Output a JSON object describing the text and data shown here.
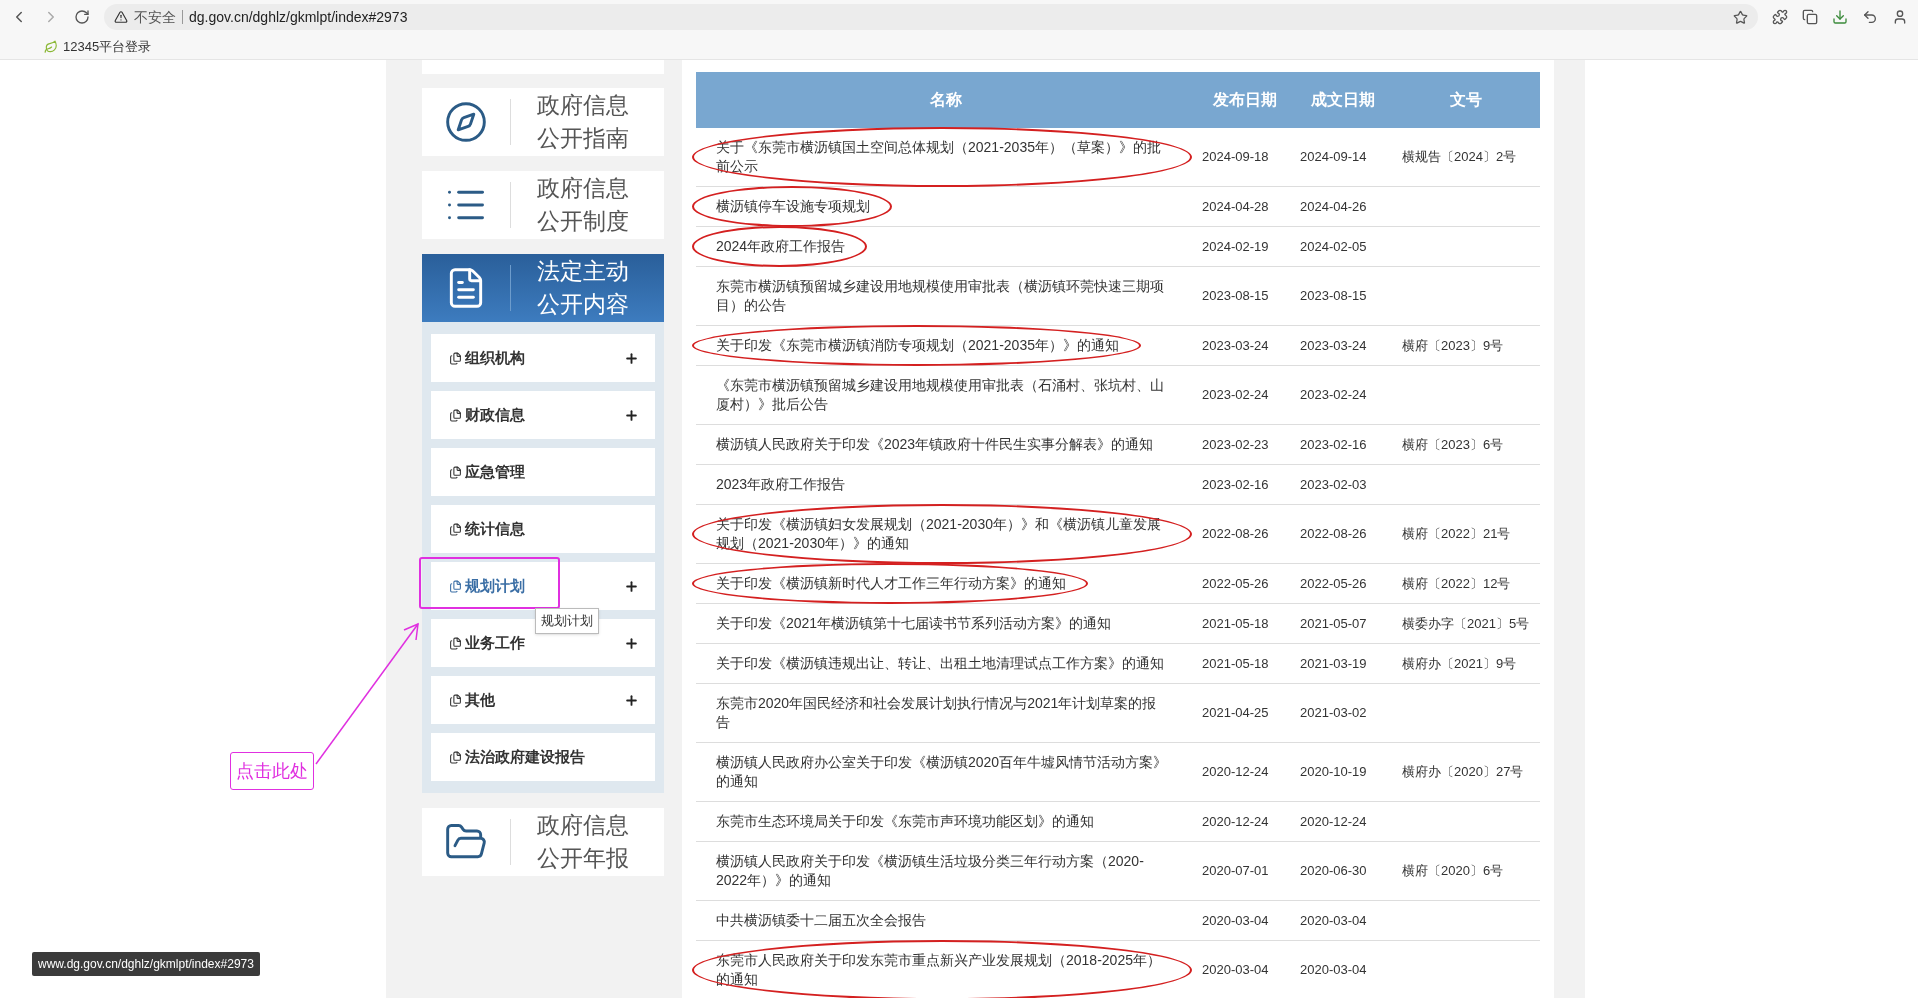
{
  "browser": {
    "security_label": "不安全",
    "url": "dg.gov.cn/dghlz/gkmlpt/index#2973",
    "bookmarks": [
      {
        "label": "12345平台登录"
      }
    ],
    "status_url": "www.dg.gov.cn/dghlz/gkmlpt/index#2973"
  },
  "sidebar": {
    "cards": [
      {
        "kind": "compass",
        "lines": [
          "政府信息",
          "公开指南"
        ],
        "selected": false
      },
      {
        "kind": "list",
        "lines": [
          "政府信息",
          "公开制度"
        ],
        "selected": false
      },
      {
        "kind": "document",
        "lines": [
          "法定主动",
          "公开内容"
        ],
        "selected": true,
        "items": [
          {
            "label": "组织机构",
            "expandable": true,
            "hovered": false,
            "highlighted": false
          },
          {
            "label": "财政信息",
            "expandable": true,
            "hovered": false,
            "highlighted": false
          },
          {
            "label": "应急管理",
            "expandable": false,
            "hovered": false,
            "highlighted": false
          },
          {
            "label": "统计信息",
            "expandable": false,
            "hovered": false,
            "highlighted": false
          },
          {
            "label": "规划计划",
            "expandable": true,
            "hovered": true,
            "highlighted": true,
            "tooltip": "规划计划"
          },
          {
            "label": "业务工作",
            "expandable": true,
            "hovered": false,
            "highlighted": false
          },
          {
            "label": "其他",
            "expandable": true,
            "hovered": false,
            "highlighted": false
          },
          {
            "label": "法治政府建设报告",
            "expandable": false,
            "hovered": false,
            "highlighted": false
          }
        ]
      },
      {
        "kind": "folder",
        "lines": [
          "政府信息",
          "公开年报"
        ],
        "selected": false
      }
    ]
  },
  "callout": {
    "label": "点击此处"
  },
  "table": {
    "columns": [
      "名称",
      "发布日期",
      "成文日期",
      "文号"
    ],
    "rows": [
      {
        "name": "关于《东莞市横沥镇国土空间总体规划（2021-2035年）（草案）》的批前公示",
        "published": "2024-09-18",
        "dated": "2024-09-14",
        "doc_no": "横规告〔2024〕2号",
        "circled": true
      },
      {
        "name": "横沥镇停车设施专项规划",
        "published": "2024-04-28",
        "dated": "2024-04-26",
        "circled": true
      },
      {
        "name": "2024年政府工作报告",
        "published": "2024-02-19",
        "dated": "2024-02-05",
        "circled": true
      },
      {
        "name": "东莞市横沥镇预留城乡建设用地规模使用审批表（横沥镇环莞快速三期项目）的公告",
        "published": "2023-08-15",
        "dated": "2023-08-15",
        "circled": false
      },
      {
        "name": "关于印发《东莞市横沥镇消防专项规划（2021-2035年）》的通知",
        "published": "2023-03-24",
        "dated": "2023-03-24",
        "doc_no": "横府〔2023〕9号",
        "circled": true
      },
      {
        "name": "《东莞市横沥镇预留城乡建设用地规模使用审批表（石涌村、张坑村、山厦村）》批后公告",
        "published": "2023-02-24",
        "dated": "2023-02-24",
        "circled": false
      },
      {
        "name": "横沥镇人民政府关于印发《2023年镇政府十件民生实事分解表》的通知",
        "published": "2023-02-23",
        "dated": "2023-02-16",
        "doc_no": "横府〔2023〕6号",
        "circled": false
      },
      {
        "name": "2023年政府工作报告",
        "published": "2023-02-16",
        "dated": "2023-02-03",
        "circled": false
      },
      {
        "name": "关于印发《横沥镇妇女发展规划（2021-2030年）》和《横沥镇儿童发展规划（2021-2030年）》的通知",
        "published": "2022-08-26",
        "dated": "2022-08-26",
        "doc_no": "横府〔2022〕21号",
        "circled": true
      },
      {
        "name": "关于印发《横沥镇新时代人才工作三年行动方案》的通知",
        "published": "2022-05-26",
        "dated": "2022-05-26",
        "doc_no": "横府〔2022〕12号",
        "circled": true
      },
      {
        "name": "关于印发《2021年横沥镇第十七届读书节系列活动方案》的通知",
        "published": "2021-05-18",
        "dated": "2021-05-07",
        "doc_no": "横委办字〔2021〕5号",
        "circled": false
      },
      {
        "name": "关于印发《横沥镇违规出让、转让、出租土地清理试点工作方案》的通知",
        "published": "2021-05-18",
        "dated": "2021-03-19",
        "doc_no": "横府办〔2021〕9号",
        "circled": false
      },
      {
        "name": "东莞市2020年国民经济和社会发展计划执行情况与2021年计划草案的报告",
        "published": "2021-04-25",
        "dated": "2021-03-02",
        "circled": false
      },
      {
        "name": "横沥镇人民政府办公室关于印发《横沥镇2020百年牛墟风情节活动方案》的通知",
        "published": "2020-12-24",
        "dated": "2020-10-19",
        "doc_no": "横府办〔2020〕27号",
        "circled": false
      },
      {
        "name": "东莞市生态环境局关于印发《东莞市声环境功能区划》的通知",
        "published": "2020-12-24",
        "dated": "2020-12-24",
        "circled": false
      },
      {
        "name": "横沥镇人民政府关于印发《横沥镇生活垃圾分类三年行动方案（2020-2022年）》的通知",
        "published": "2020-07-01",
        "dated": "2020-06-30",
        "doc_no": "横府〔2020〕6号",
        "circled": false
      },
      {
        "name": "中共横沥镇委十二届五次全会报告",
        "published": "2020-03-04",
        "dated": "2020-03-04",
        "circled": false
      },
      {
        "name": "东莞市人民政府关于印发东莞市重点新兴产业发展规划（2018-2025年）的通知",
        "published": "2020-03-04",
        "dated": "2020-03-04",
        "circled": true
      }
    ]
  }
}
